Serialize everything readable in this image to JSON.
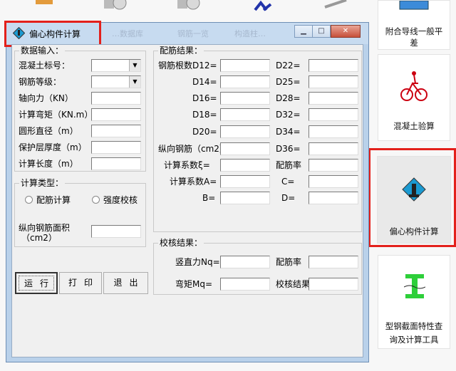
{
  "window": {
    "title": "偏心构件计算",
    "ghost_texts": [
      "…数据库",
      "钢筋一览",
      "构造柱…"
    ]
  },
  "input_group": {
    "caption": "数据输入：",
    "fields": [
      {
        "label": "混凝土标号：",
        "value": ""
      },
      {
        "label": "钢筋等级：",
        "value": ""
      },
      {
        "label": "轴向力（KN）",
        "value": ""
      },
      {
        "label": "计算弯矩（KN.m）",
        "value": ""
      },
      {
        "label": "圆形直径（m）",
        "value": ""
      },
      {
        "label": "保护层厚度（m）",
        "value": ""
      },
      {
        "label": "计算长度（m）",
        "value": ""
      }
    ]
  },
  "calc_type": {
    "caption": "计算类型：",
    "option1": "配筋计算",
    "option2": "强度校核",
    "area_label": "纵向钢筋面积",
    "area_unit": "（cm2）",
    "area_value": ""
  },
  "buttons": {
    "run": "运行",
    "print": "打印",
    "exit": "退出"
  },
  "result_group": {
    "caption": "配筋结果：",
    "left": [
      {
        "label": "钢筋根数D12=",
        "value": ""
      },
      {
        "label": "D14=",
        "value": ""
      },
      {
        "label": "D16=",
        "value": ""
      },
      {
        "label": "D18=",
        "value": ""
      },
      {
        "label": "D20=",
        "value": ""
      },
      {
        "label": "纵向钢筋（cm2）",
        "value": ""
      },
      {
        "label": "计算系数ξ=",
        "value": ""
      },
      {
        "label": "计算系数A=",
        "value": ""
      },
      {
        "label": "B=",
        "value": ""
      }
    ],
    "right": [
      {
        "label": "D22=",
        "value": ""
      },
      {
        "label": "D25=",
        "value": ""
      },
      {
        "label": "D28=",
        "value": ""
      },
      {
        "label": "D32=",
        "value": ""
      },
      {
        "label": "D34=",
        "value": ""
      },
      {
        "label": "D36=",
        "value": ""
      },
      {
        "label": "配筋率",
        "value": ""
      },
      {
        "label": "C=",
        "value": ""
      },
      {
        "label": "D=",
        "value": ""
      }
    ]
  },
  "check_group": {
    "caption": "校核结果：",
    "fields": [
      {
        "label": "竖直力Nq=",
        "value": ""
      },
      {
        "label": "配筋率",
        "value": ""
      },
      {
        "label": "弯矩Mq=",
        "value": ""
      },
      {
        "label": "校核结果",
        "value": ""
      }
    ]
  },
  "desktop": {
    "tile1": [
      "附合导线一般平",
      "差"
    ],
    "tile2": "混凝土验算",
    "tile3": "偏心构件计算",
    "tile4": [
      "型钢截面特性查",
      "询及计算工具"
    ]
  },
  "colors": {
    "highlight": "#e3201b",
    "titlebar": "#c7dbf0"
  }
}
